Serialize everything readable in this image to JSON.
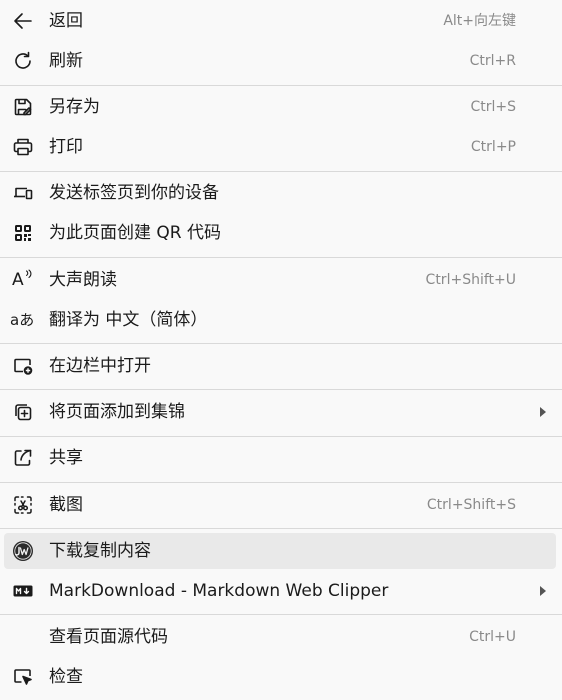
{
  "menu": {
    "items": [
      {
        "label": "返回",
        "shortcut": "Alt+向左键",
        "icon": "back-arrow-icon"
      },
      {
        "label": "刷新",
        "shortcut": "Ctrl+R",
        "icon": "refresh-icon"
      },
      {
        "label": "另存为",
        "shortcut": "Ctrl+S",
        "icon": "save-icon"
      },
      {
        "label": "打印",
        "shortcut": "Ctrl+P",
        "icon": "print-icon"
      },
      {
        "label": "发送标签页到你的设备",
        "shortcut": "",
        "icon": "devices-icon"
      },
      {
        "label": "为此页面创建 QR 代码",
        "shortcut": "",
        "icon": "qr-code-icon"
      },
      {
        "label": "大声朗读",
        "shortcut": "Ctrl+Shift+U",
        "icon": "read-aloud-icon",
        "icon_text": "A"
      },
      {
        "label": "翻译为 中文（简体）",
        "shortcut": "",
        "icon": "translate-icon",
        "icon_text": "aあ"
      },
      {
        "label": "在边栏中打开",
        "shortcut": "",
        "icon": "sidebar-open-icon"
      },
      {
        "label": "将页面添加到集锦",
        "shortcut": "",
        "icon": "collections-add-icon",
        "submenu": true
      },
      {
        "label": "共享",
        "shortcut": "",
        "icon": "share-icon"
      },
      {
        "label": "截图",
        "shortcut": "Ctrl+Shift+S",
        "icon": "screenshot-icon"
      },
      {
        "label": "下载复制内容",
        "shortcut": "",
        "icon": "extension-download-icon",
        "highlighted": true
      },
      {
        "label": "MarkDownload - Markdown Web Clipper",
        "shortcut": "",
        "icon": "markdown-icon",
        "icon_text": "M↓",
        "submenu": true
      },
      {
        "label": "查看页面源代码",
        "shortcut": "Ctrl+U",
        "icon": ""
      },
      {
        "label": "检查",
        "shortcut": "",
        "icon": "inspect-icon"
      }
    ]
  },
  "colors": {
    "background": "#f9f9f9",
    "highlight": "#e9e9e9",
    "separator": "#d9d9d9",
    "text": "#1b1b1b",
    "shortcut": "#8a8a8a"
  }
}
